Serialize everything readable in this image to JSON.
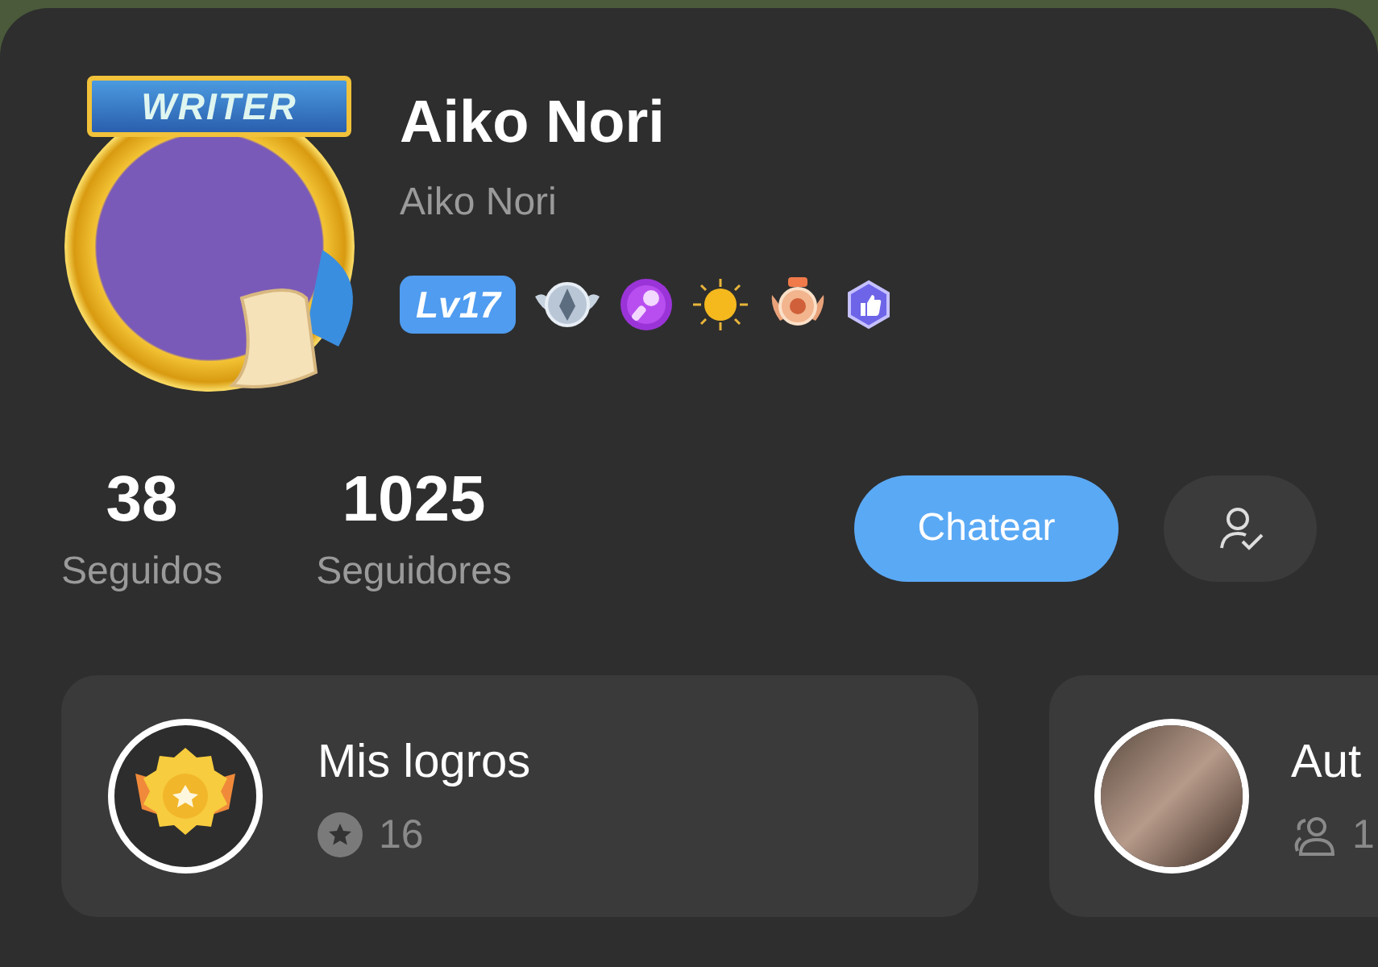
{
  "profile": {
    "frame_label": "WRITER",
    "name": "Aiko Nori",
    "username": "Aiko Nori",
    "level": "Lv17",
    "badges": [
      {
        "kind": "pen"
      },
      {
        "kind": "mic"
      },
      {
        "kind": "sun"
      },
      {
        "kind": "trophy"
      },
      {
        "kind": "thumb"
      }
    ]
  },
  "stats": [
    {
      "value": "38",
      "label": "Seguidos"
    },
    {
      "value": "1025",
      "label": "Seguidores"
    }
  ],
  "actions": {
    "chat": "Chatear"
  },
  "cards": [
    {
      "kind": "achievements",
      "title": "Mis logros",
      "count": "16"
    },
    {
      "kind": "group",
      "title": "Aut",
      "count": "1"
    }
  ]
}
